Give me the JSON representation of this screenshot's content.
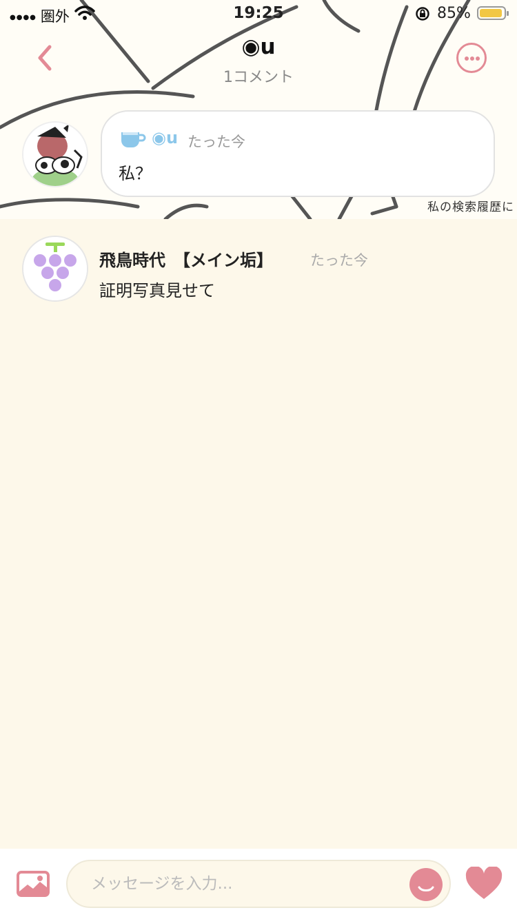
{
  "status_bar": {
    "carrier": "圏外",
    "time": "19:25",
    "battery_pct": "85%"
  },
  "header": {
    "title": "◉u",
    "subtitle": "1コメント",
    "background_caption": "私の検索履歴に"
  },
  "top_comment": {
    "author": "◉u",
    "time": "たった今",
    "text": "私？"
  },
  "replies": [
    {
      "author": "飛鳥時代　【メイン垢】",
      "time": "たった今",
      "text": "証明写真見せて"
    }
  ],
  "composer": {
    "placeholder": "メッセージを入力..."
  },
  "colors": {
    "accent": "#e38a95",
    "background": "#fdf8ea",
    "username_blue": "#8cc7ea",
    "grape_purple": "#c7a6ea",
    "grape_stem": "#9ad85a"
  },
  "icons": [
    "back-chevron-icon",
    "more-icon",
    "cup-icon",
    "image-icon",
    "emoji-icon",
    "heart-icon",
    "wifi-icon",
    "rotation-lock-icon",
    "battery-icon"
  ]
}
